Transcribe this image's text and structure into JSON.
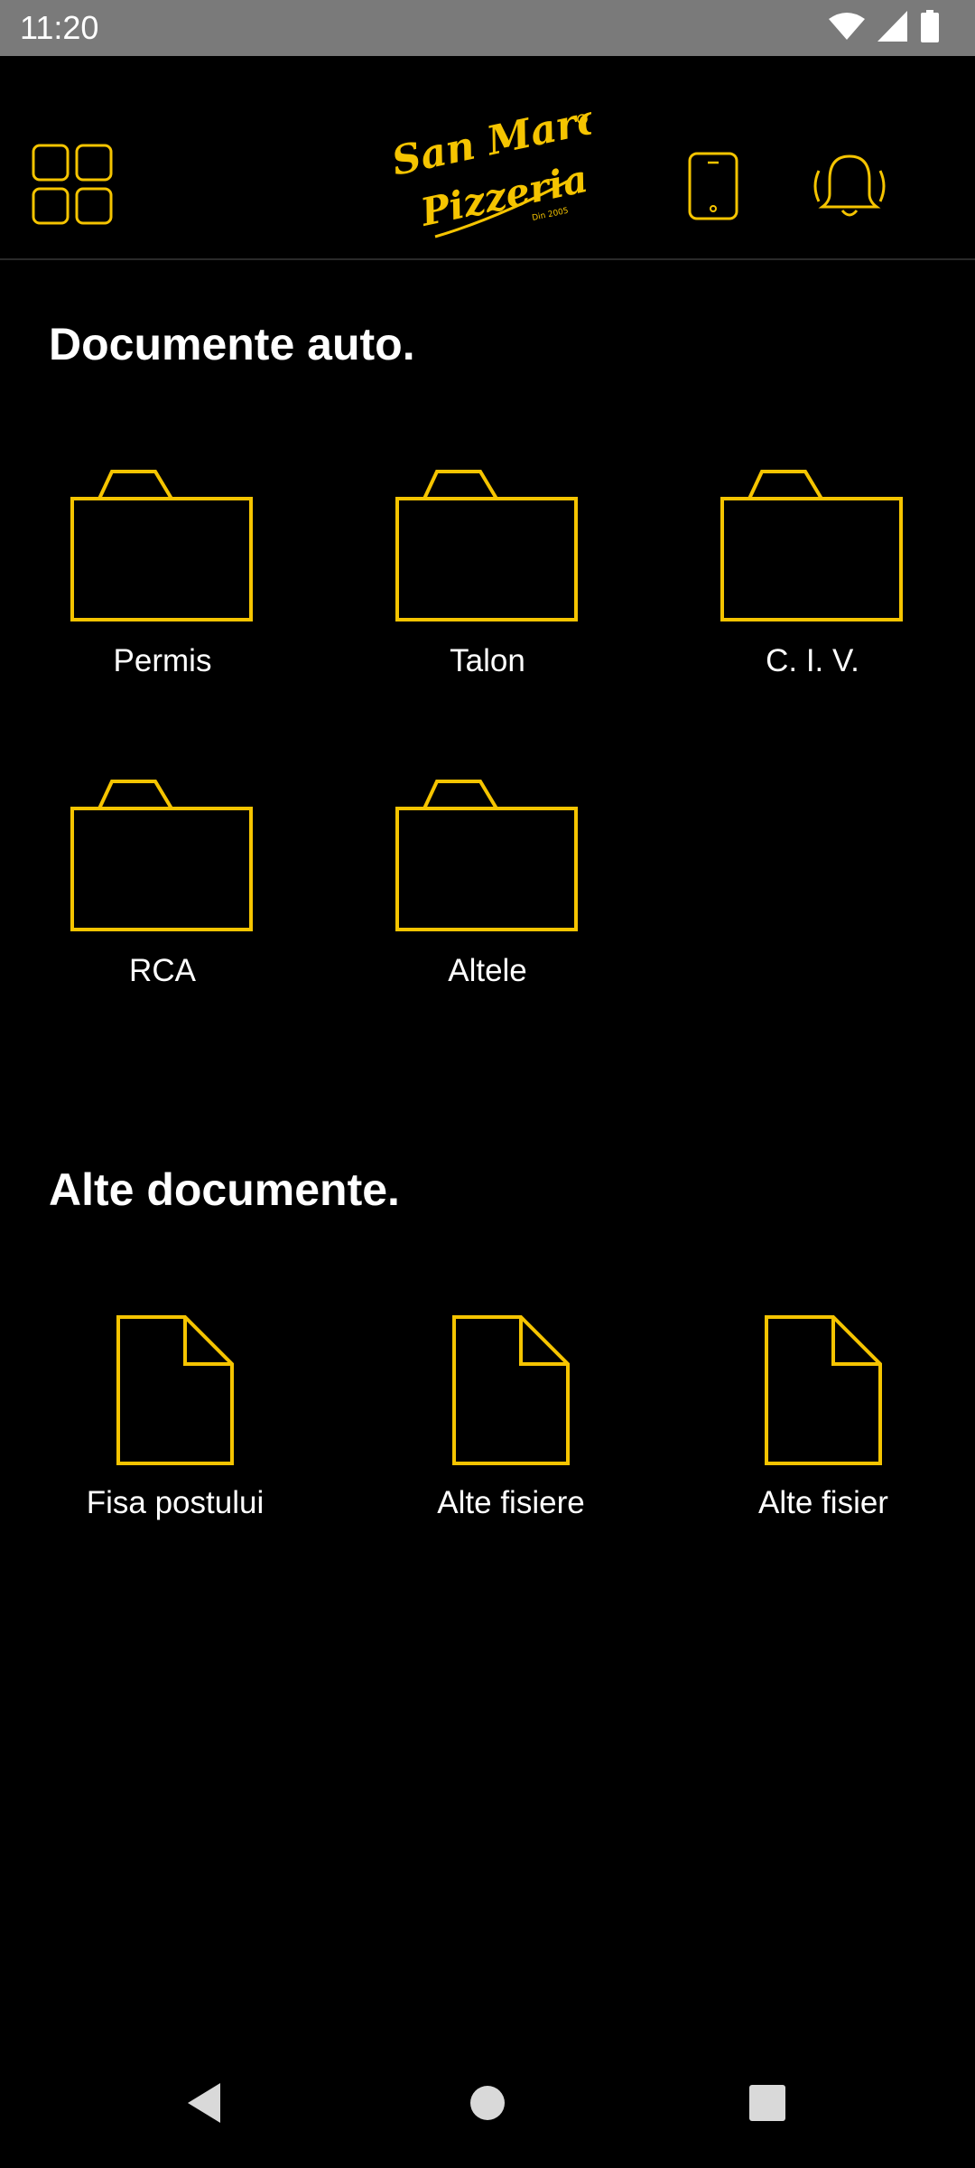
{
  "status_bar": {
    "time": "11:20",
    "icons": [
      "wifi-icon",
      "signal-icon",
      "battery-icon"
    ]
  },
  "app_bar": {
    "menu_icon": "grid-menu-icon",
    "logo": {
      "line1": "San Marco",
      "line2": "Pizzeria",
      "tagline": "Din 2005"
    },
    "device_icon": "phone-icon",
    "notification_icon": "bell-icon"
  },
  "colors": {
    "accent": "#F5C400",
    "background": "#000000",
    "text": "#FFFFFF",
    "statusbar": "#7A7A7A"
  },
  "sections": {
    "auto": {
      "title": "Documente auto.",
      "folders": [
        {
          "label": "Permis"
        },
        {
          "label": "Talon"
        },
        {
          "label": "C. I. V."
        },
        {
          "label": "RCA"
        },
        {
          "label": "Altele"
        }
      ]
    },
    "other": {
      "title": "Alte documente.",
      "files": [
        {
          "label": "Fisa postului"
        },
        {
          "label": "Alte fisiere"
        },
        {
          "label": "Alte fisier"
        }
      ]
    }
  },
  "nav_bar": {
    "icons": [
      "back-icon",
      "home-icon",
      "recents-icon"
    ]
  }
}
